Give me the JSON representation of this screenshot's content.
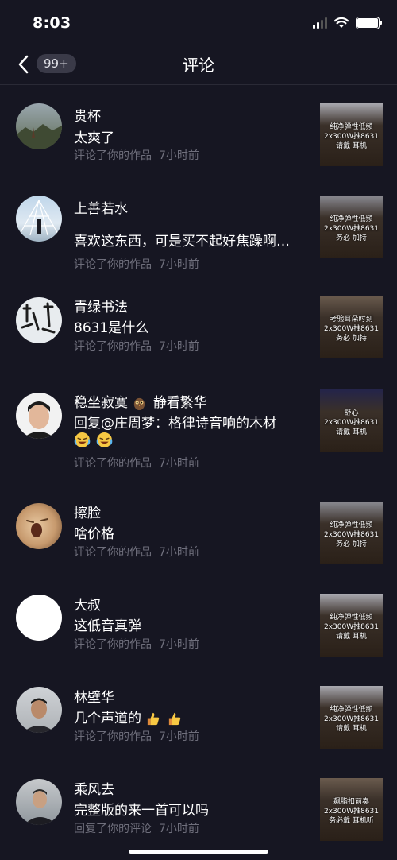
{
  "status_bar": {
    "time": "8:03"
  },
  "nav": {
    "badge": "99+",
    "title": "评论"
  },
  "colors": {
    "background": "#161622",
    "meta_text": "#6f6f7c",
    "badge_bg": "#3a3a48"
  },
  "comments": [
    {
      "username": "贵杯",
      "text": "太爽了",
      "action": "评论了你的作品",
      "time": "7小时前",
      "thumb": [
        "纯净弹性低频",
        "2x300W推8631",
        "请戴    耳机"
      ]
    },
    {
      "username": "上善若水",
      "text": "喜欢这东西，可是买不起好焦躁啊…",
      "action": "评论了你的作品",
      "time": "7小时前",
      "thumb": [
        "纯净弹性低频",
        "2x300W推8631",
        "务必   加持"
      ]
    },
    {
      "username": "青绿书法",
      "text": "8631是什么",
      "action": "评论了你的作品",
      "time": "7小时前",
      "thumb": [
        "考验耳朵时刻",
        "2x300W推8631",
        "务必   加持"
      ]
    },
    {
      "username": "稳坐寂寞",
      "username_suffix": "静看繁华",
      "text": "回复@庄周梦：格律诗音响的木材",
      "action": "评论了你的作品",
      "time": "7小时前",
      "thumb": [
        "舒心",
        "2x300W推8631",
        "请戴    耳机"
      ],
      "emoji_icons": [
        "owl-emoji-icon",
        "laughing-tears-emoji-icon",
        "laughing-tears-emoji-icon"
      ]
    },
    {
      "username": "擦脸",
      "text": "啥价格",
      "action": "评论了你的作品",
      "time": "7小时前",
      "thumb": [
        "纯净弹性低频",
        "2x300W推8631",
        "务必   加持"
      ]
    },
    {
      "username": "大叔",
      "text": "这低音真弹",
      "action": "评论了你的作品",
      "time": "7小时前",
      "thumb": [
        "纯净弹性低频",
        "2x300W推8631",
        "请戴    耳机"
      ]
    },
    {
      "username": "林壁华",
      "text": "几个声道的",
      "action": "评论了你的作品",
      "time": "7小时前",
      "thumb": [
        "纯净弹性低频",
        "2x300W推8631",
        "请戴    耳机"
      ],
      "emoji_icons": [
        "thumbs-up-emoji-icon",
        "thumbs-up-emoji-icon"
      ]
    },
    {
      "username": "乘风去",
      "text": "完整版的来一首可以吗",
      "action": "回复了你的评论",
      "time": "7小时前",
      "thumb": [
        "飙脂扣前奏",
        "2x300W推8631",
        "务必戴   耳机听"
      ]
    }
  ]
}
